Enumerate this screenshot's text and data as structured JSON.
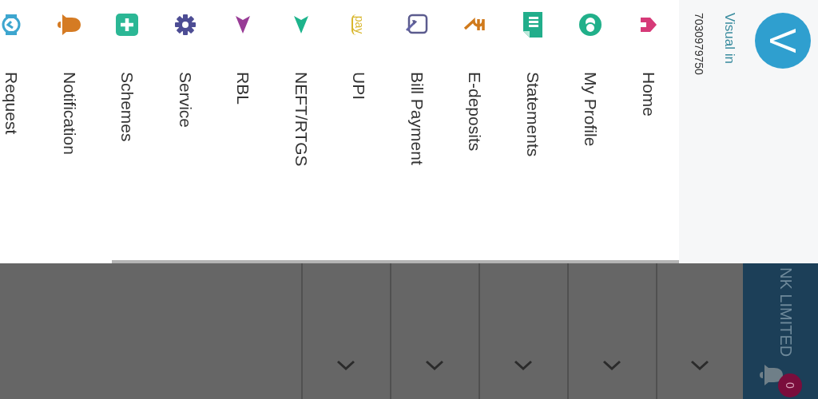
{
  "drawer": {
    "header": {
      "avatar_letter": "V",
      "name": "Visual in",
      "phone": "7030979750"
    },
    "items": [
      {
        "label": "Home",
        "kind": "home"
      },
      {
        "label": "My Profile",
        "kind": "profile"
      },
      {
        "label": "Statements",
        "kind": "statements"
      },
      {
        "label": "E-deposits",
        "kind": "deposits"
      },
      {
        "label": "Bill Payment",
        "kind": "bill"
      },
      {
        "label": "UPI",
        "kind": "upi",
        "icon_text": "pay"
      },
      {
        "label": "NEFT/RTGS",
        "kind": "transfer"
      },
      {
        "label": "RBL",
        "kind": "rbl"
      },
      {
        "label": "Service",
        "kind": "service"
      },
      {
        "label": "Schemes",
        "kind": "schemes"
      },
      {
        "label": "Notification",
        "kind": "notification"
      },
      {
        "label": "Request",
        "kind": "request"
      }
    ]
  },
  "app_bar": {
    "title": "NK LIMITED",
    "notification_count": "0"
  },
  "list_rows": [
    {
      "kind": "chevron"
    },
    {
      "kind": "chevron"
    },
    {
      "kind": "chevron"
    },
    {
      "kind": "chevron"
    },
    {
      "kind": "chevron"
    },
    {
      "kind": "blank"
    }
  ]
}
